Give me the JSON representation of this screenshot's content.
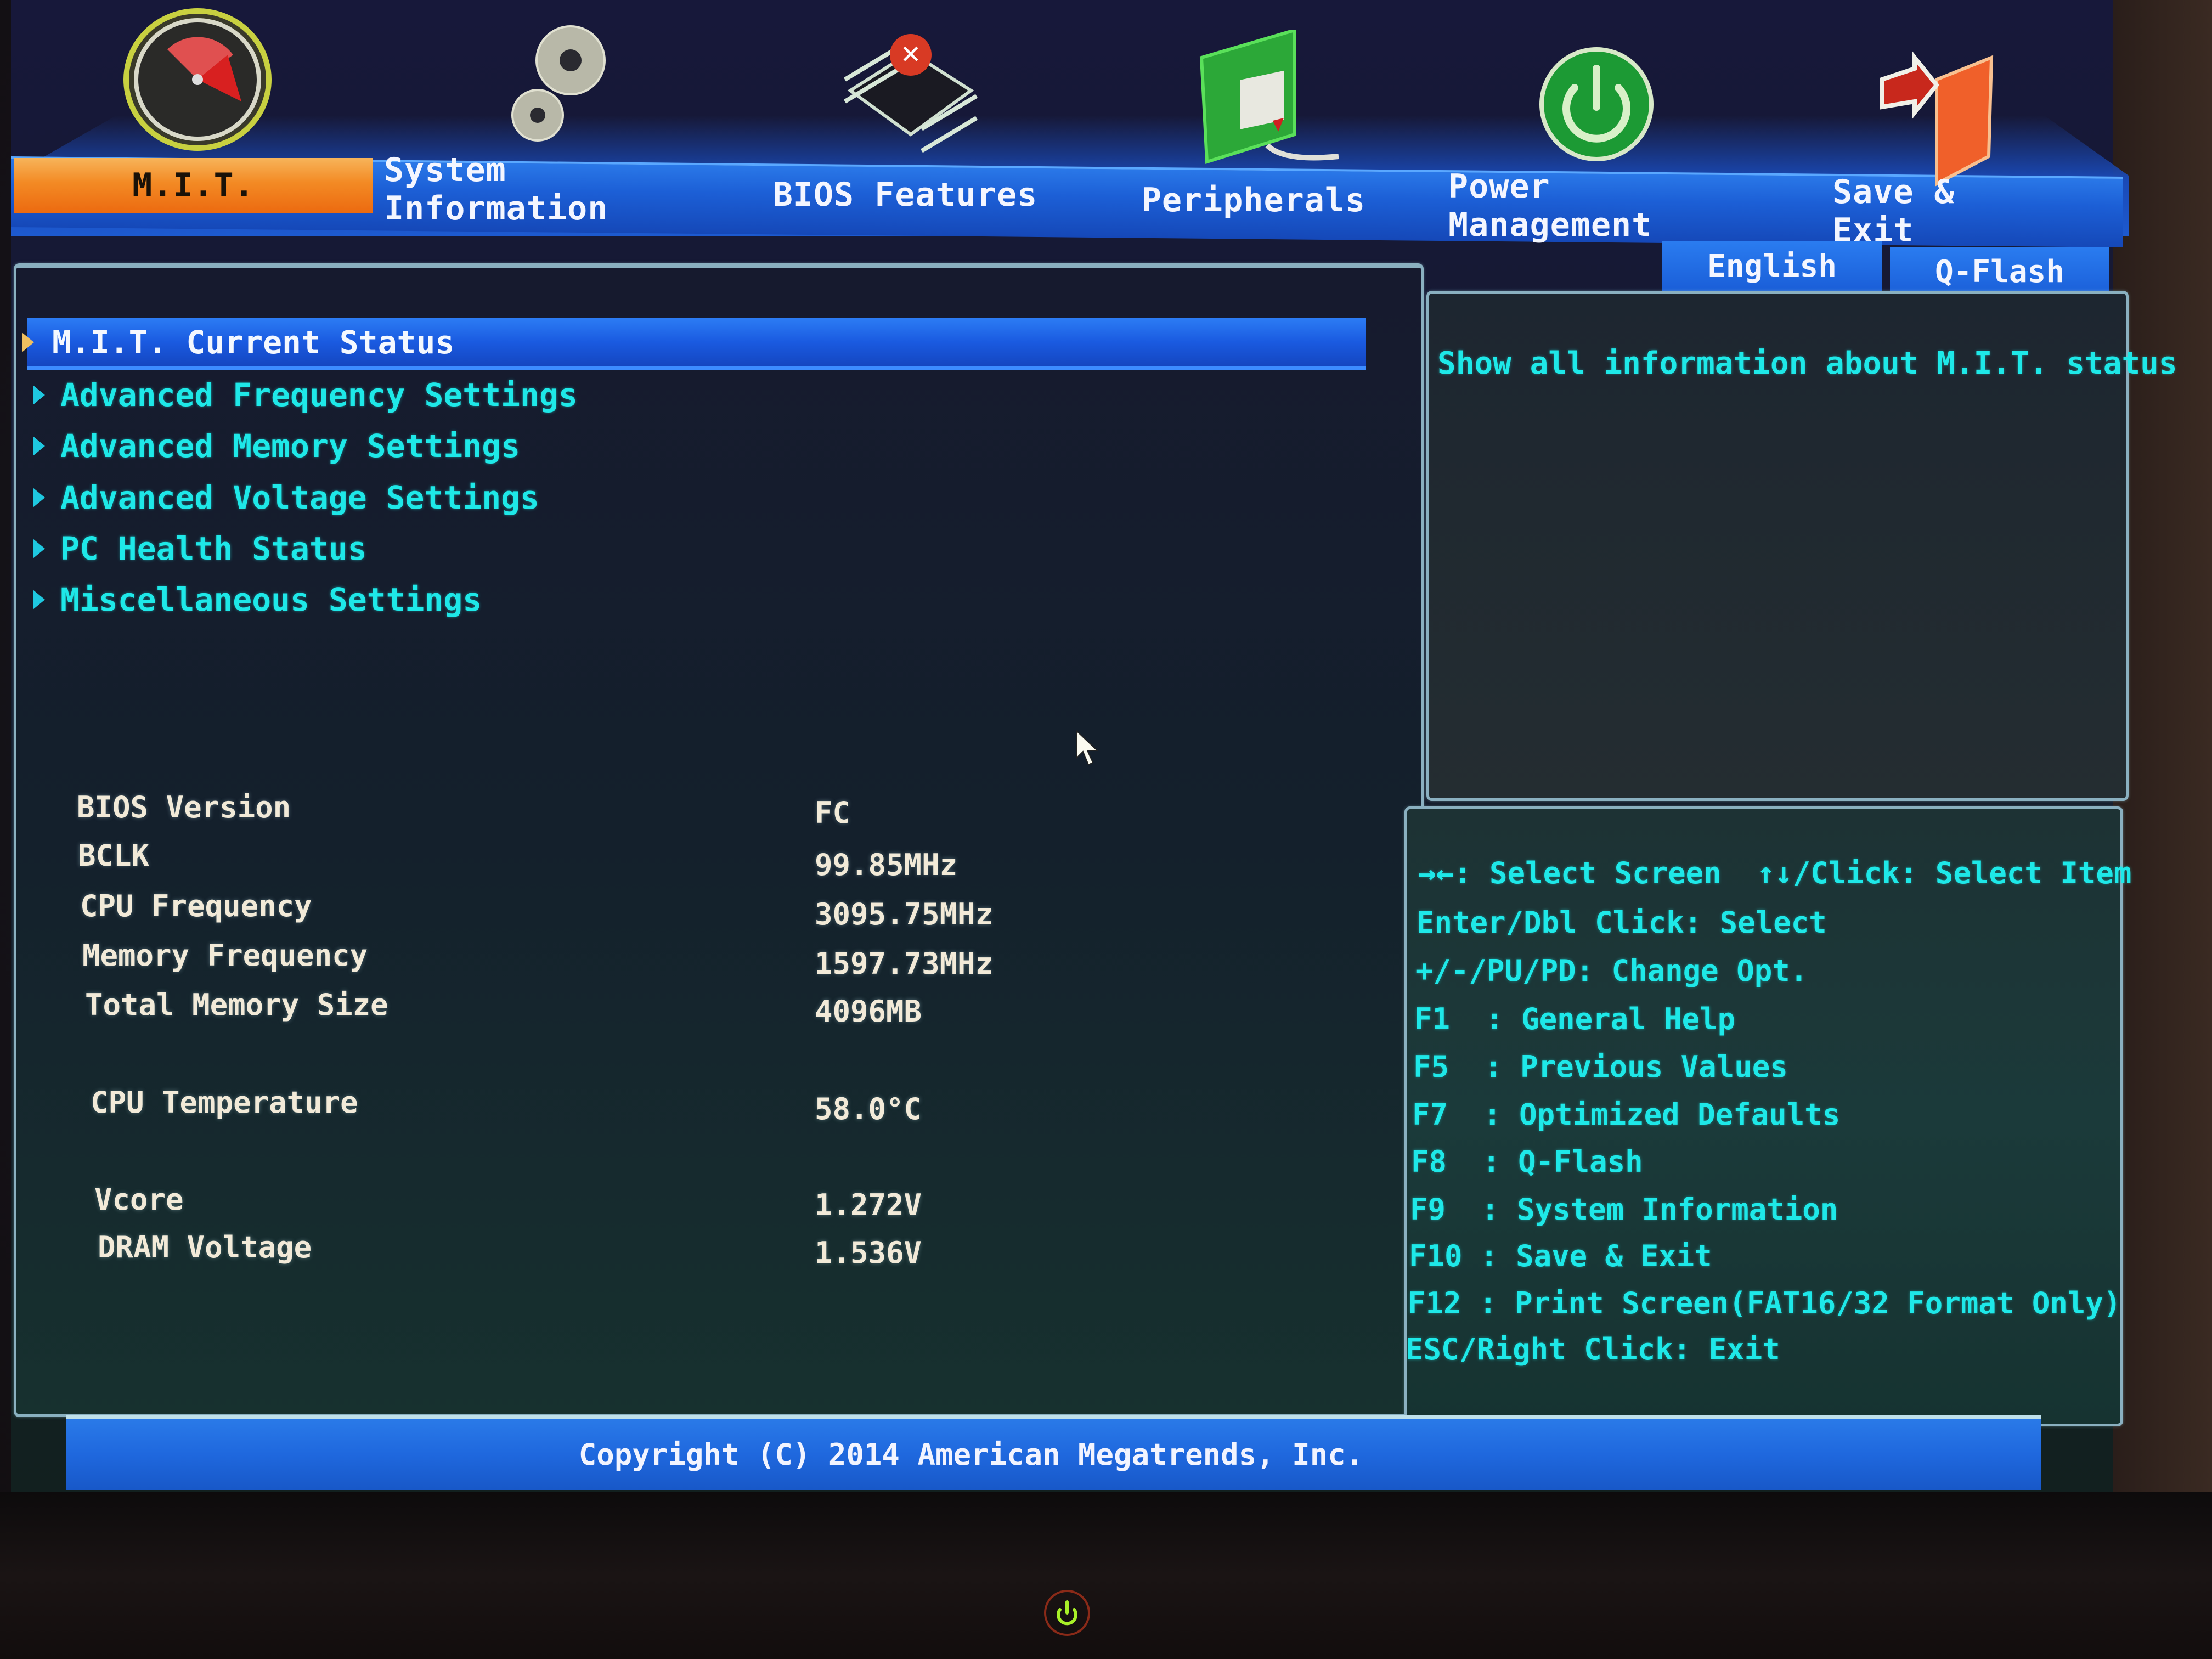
{
  "nav": {
    "tabs": [
      {
        "label": "M.I.T.",
        "icon": "speedometer-icon",
        "active": true
      },
      {
        "label": "System Information",
        "icon": "gears-icon",
        "active": false
      },
      {
        "label": "BIOS Features",
        "icon": "chip-icon",
        "active": false
      },
      {
        "label": "Peripherals",
        "icon": "pci-card-icon",
        "active": false
      },
      {
        "label": "Power Management",
        "icon": "power-icon",
        "active": false
      },
      {
        "label": "Save & Exit",
        "icon": "exit-door-icon",
        "active": false
      }
    ],
    "language_button": "English",
    "qflash_button": "Q-Flash"
  },
  "menu": {
    "items": [
      {
        "label": "M.I.T. Current Status",
        "selected": true
      },
      {
        "label": "Advanced Frequency Settings",
        "selected": false
      },
      {
        "label": "Advanced Memory Settings",
        "selected": false
      },
      {
        "label": "Advanced Voltage Settings",
        "selected": false
      },
      {
        "label": "PC Health Status",
        "selected": false
      },
      {
        "label": "Miscellaneous Settings",
        "selected": false
      }
    ]
  },
  "status": {
    "rows": [
      {
        "label": "BIOS Version",
        "value": "FC"
      },
      {
        "label": "BCLK",
        "value": "99.85MHz"
      },
      {
        "label": "CPU Frequency",
        "value": "3095.75MHz"
      },
      {
        "label": "Memory Frequency",
        "value": "1597.73MHz"
      },
      {
        "label": "Total Memory Size",
        "value": "4096MB"
      },
      {
        "label": "CPU Temperature",
        "value": "58.0°C"
      },
      {
        "label": "Vcore",
        "value": "1.272V"
      },
      {
        "label": "DRAM Voltage",
        "value": "1.536V"
      }
    ]
  },
  "help": {
    "text": "Show all information about M.I.T. status"
  },
  "keys": {
    "lines": [
      "→←: Select Screen  ↑↓/Click: Select Item",
      "Enter/Dbl Click: Select",
      "+/-/PU/PD: Change Opt.",
      "F1  : General Help",
      "F5  : Previous Values",
      "F7  : Optimized Defaults",
      "F8  : Q-Flash",
      "F9  : System Information",
      "F10 : Save & Exit",
      "F12 : Print Screen(FAT16/32 Format Only)",
      "ESC/Right Click: Exit"
    ]
  },
  "footer": {
    "copyright": "Copyright (C) 2014 American Megatrends, Inc."
  },
  "colors": {
    "accent_orange": "#f38a24",
    "nav_blue": "#1c5fd6",
    "menu_cyan": "#1ee8e8",
    "value_white": "#f2ead8"
  }
}
